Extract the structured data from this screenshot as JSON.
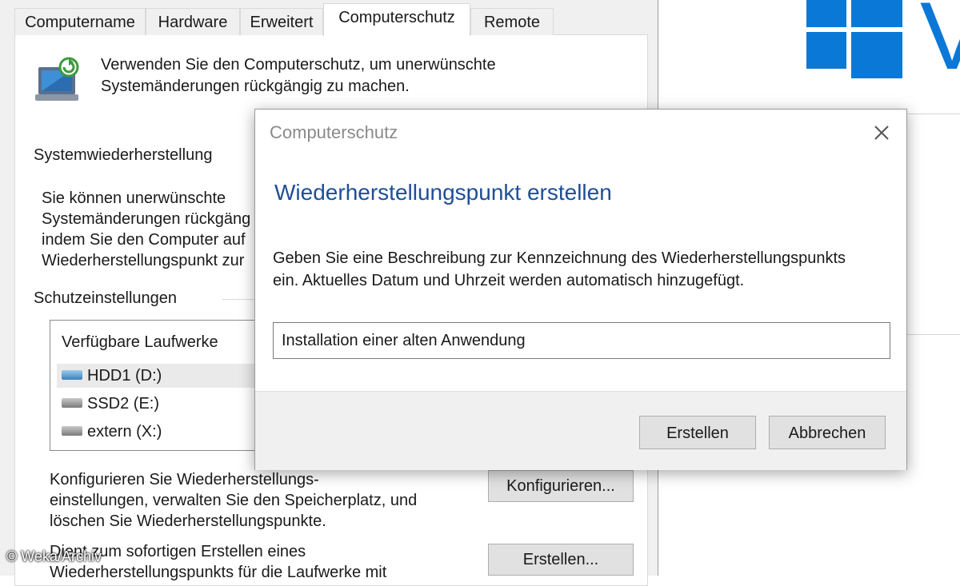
{
  "system_properties": {
    "tabs": [
      {
        "label": "Computername"
      },
      {
        "label": "Hardware"
      },
      {
        "label": "Erweitert"
      },
      {
        "label": "Computerschutz"
      },
      {
        "label": "Remote"
      }
    ],
    "intro_line1": "Verwenden Sie den Computerschutz, um unerwünschte",
    "intro_line2": "Systemänderungen rückgängig zu machen.",
    "section_restore": "Systemwiederherstellung",
    "restore_text": [
      "Sie können unerwünschte",
      "Systemänderungen rückgäng",
      "indem Sie den Computer auf",
      "Wiederherstellungspunkt zur"
    ],
    "section_protection": "Schutzeinstellungen",
    "drives_header": "Verfügbare Laufwerke",
    "drives": [
      {
        "label": "HDD1 (D:)"
      },
      {
        "label": "SSD2 (E:)"
      },
      {
        "label": "extern (X:)"
      }
    ],
    "configure_text": [
      "Konfigurieren Sie Wiederherstellungs-",
      "einstellungen, verwalten Sie den Speicherplatz, und",
      "löschen Sie Wiederherstellungspunkte."
    ],
    "configure_button": "Konfigurieren...",
    "create_text": [
      "Dient zum sofortigen Erstellen eines",
      "Wiederherstellungspunkts für die Laufwerke mit"
    ],
    "create_button": "Erstellen..."
  },
  "dialog": {
    "title": "Computerschutz",
    "heading": "Wiederherstellungspunkt erstellen",
    "description_line1": "Geben Sie eine Beschreibung zur Kennzeichnung des Wiederherstellungspunkts",
    "description_line2": "ein. Aktuelles Datum und Uhrzeit werden automatisch hinzugefügt.",
    "input_value": "Installation einer alten Anwendung",
    "create_button": "Erstellen",
    "cancel_button": "Abbrechen"
  },
  "background_letter": "V",
  "watermark": "© Weka/Archiv",
  "colors": {
    "heading_blue": "#1f4e96",
    "windows_blue": "#0a78d7"
  },
  "icons": [
    "windows-logo-icon",
    "system-protection-icon",
    "drive-icon",
    "close-icon"
  ]
}
